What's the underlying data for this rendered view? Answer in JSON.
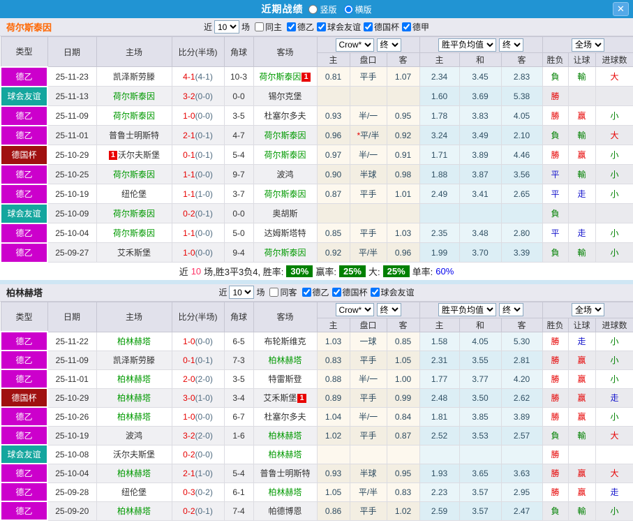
{
  "titlebar": {
    "title": "近期战绩",
    "vertical": "竖版",
    "horizontal": "横版",
    "selected": "横版",
    "close_label": "✕"
  },
  "colors": {
    "titlebar_bg": "#2194d3",
    "type_colors": {
      "德乙": "#cc00cc",
      "球会友谊": "#14a69e",
      "德国杯": "#a01010"
    },
    "team_green": "#009900",
    "score_red": "#e60000",
    "badge_red": "#e80000",
    "summary_green": "#008000"
  },
  "table_header": {
    "col_type": "类型",
    "col_date": "日期",
    "col_home": "主场",
    "col_score": "比分(半场)",
    "col_corner": "角球",
    "col_away": "客场",
    "odds_source": "Crow*",
    "final_a": "终",
    "avg_label": "胜平负均值",
    "final_b": "终",
    "scope": "全场",
    "sub_home": "主",
    "sub_handicap": "盘口",
    "sub_away": "客",
    "sub_avg_home": "主",
    "sub_avg_draw": "和",
    "sub_avg_away": "客",
    "col_result": "胜负",
    "col_handicap_result": "让球",
    "col_goals": "进球数"
  },
  "sections": [
    {
      "team": "荷尔斯泰因",
      "filter": {
        "near_label": "近",
        "count": "10",
        "games_label": "场",
        "same": {
          "label": "同主",
          "checked": false
        },
        "leagues": [
          {
            "label": "德乙",
            "checked": true
          },
          {
            "label": "球会友谊",
            "checked": true
          },
          {
            "label": "德国杯",
            "checked": true
          },
          {
            "label": "德甲",
            "checked": true
          }
        ]
      },
      "rows": [
        {
          "type": "德乙",
          "date": "25-11-23",
          "home": {
            "name": "凯泽斯劳滕"
          },
          "ft": "4-1",
          "ht": "(4-1)",
          "corner": "10-3",
          "away": {
            "name": "荷尔斯泰因",
            "green": true,
            "badge": "1",
            "badge_pos": "after"
          },
          "odds": [
            "0.81",
            "平手",
            "1.07"
          ],
          "avg": [
            "2.34",
            "3.45",
            "2.83"
          ],
          "res": [
            [
              "負",
              "g"
            ],
            [
              "輸",
              "g"
            ],
            [
              "大",
              "r"
            ]
          ]
        },
        {
          "type": "球会友谊",
          "date": "25-11-13",
          "home": {
            "name": "荷尔斯泰因",
            "green": true
          },
          "ft": "3-2",
          "ht": "(0-0)",
          "corner": "0-0",
          "away": {
            "name": "锡尔克堡"
          },
          "odds": [
            "",
            "",
            ""
          ],
          "avg": [
            "1.60",
            "3.69",
            "5.38"
          ],
          "res": [
            [
              "勝",
              "r"
            ],
            [
              "",
              ""
            ],
            [
              "",
              ""
            ]
          ]
        },
        {
          "type": "德乙",
          "date": "25-11-09",
          "home": {
            "name": "荷尔斯泰因",
            "green": true
          },
          "ft": "1-0",
          "ht": "(0-0)",
          "corner": "3-5",
          "away": {
            "name": "杜塞尔多夫"
          },
          "odds": [
            "0.93",
            "半/一",
            "0.95"
          ],
          "avg": [
            "1.78",
            "3.83",
            "4.05"
          ],
          "res": [
            [
              "勝",
              "r"
            ],
            [
              "赢",
              "r"
            ],
            [
              "小",
              "g"
            ]
          ]
        },
        {
          "type": "德乙",
          "date": "25-11-01",
          "home": {
            "name": "普鲁士明斯特"
          },
          "ft": "2-1",
          "ht": "(0-1)",
          "corner": "4-7",
          "away": {
            "name": "荷尔斯泰因",
            "green": true
          },
          "odds": [
            "0.96",
            "*平/半",
            "0.92"
          ],
          "avg": [
            "3.24",
            "3.49",
            "2.10"
          ],
          "res": [
            [
              "負",
              "g"
            ],
            [
              "輸",
              "g"
            ],
            [
              "大",
              "r"
            ]
          ]
        },
        {
          "type": "德国杯",
          "date": "25-10-29",
          "home": {
            "name": "沃尔夫斯堡",
            "badge": "1",
            "badge_pos": "before"
          },
          "ft": "0-1",
          "ht": "(0-1)",
          "corner": "5-4",
          "away": {
            "name": "荷尔斯泰因",
            "green": true
          },
          "odds": [
            "0.97",
            "半/一",
            "0.91"
          ],
          "avg": [
            "1.71",
            "3.89",
            "4.46"
          ],
          "res": [
            [
              "勝",
              "r"
            ],
            [
              "赢",
              "r"
            ],
            [
              "小",
              "g"
            ]
          ]
        },
        {
          "type": "德乙",
          "date": "25-10-25",
          "home": {
            "name": "荷尔斯泰因",
            "green": true
          },
          "ft": "1-1",
          "ht": "(0-0)",
          "corner": "9-7",
          "away": {
            "name": "波鸿"
          },
          "odds": [
            "0.90",
            "半球",
            "0.98"
          ],
          "avg": [
            "1.88",
            "3.87",
            "3.56"
          ],
          "res": [
            [
              "平",
              "b"
            ],
            [
              "輸",
              "g"
            ],
            [
              "小",
              "g"
            ]
          ]
        },
        {
          "type": "德乙",
          "date": "25-10-19",
          "home": {
            "name": "纽伦堡"
          },
          "ft": "1-1",
          "ht": "(1-0)",
          "corner": "3-7",
          "away": {
            "name": "荷尔斯泰因",
            "green": true
          },
          "odds": [
            "0.87",
            "平手",
            "1.01"
          ],
          "avg": [
            "2.49",
            "3.41",
            "2.65"
          ],
          "res": [
            [
              "平",
              "b"
            ],
            [
              "走",
              "b"
            ],
            [
              "小",
              "g"
            ]
          ]
        },
        {
          "type": "球会友谊",
          "date": "25-10-09",
          "home": {
            "name": "荷尔斯泰因",
            "green": true
          },
          "ft": "0-2",
          "ht": "(0-1)",
          "corner": "0-0",
          "away": {
            "name": "奥胡斯"
          },
          "odds": [
            "",
            "",
            ""
          ],
          "avg": [
            "",
            "",
            ""
          ],
          "res": [
            [
              "負",
              "g"
            ],
            [
              "",
              ""
            ],
            [
              "",
              ""
            ]
          ]
        },
        {
          "type": "德乙",
          "date": "25-10-04",
          "home": {
            "name": "荷尔斯泰因",
            "green": true
          },
          "ft": "1-1",
          "ht": "(0-0)",
          "corner": "5-0",
          "away": {
            "name": "达姆斯塔特"
          },
          "odds": [
            "0.85",
            "平手",
            "1.03"
          ],
          "avg": [
            "2.35",
            "3.48",
            "2.80"
          ],
          "res": [
            [
              "平",
              "b"
            ],
            [
              "走",
              "b"
            ],
            [
              "小",
              "g"
            ]
          ]
        },
        {
          "type": "德乙",
          "date": "25-09-27",
          "home": {
            "name": "艾禾斯堡"
          },
          "ft": "1-0",
          "ht": "(0-0)",
          "corner": "9-4",
          "away": {
            "name": "荷尔斯泰因",
            "green": true
          },
          "odds": [
            "0.92",
            "平/半",
            "0.96"
          ],
          "avg": [
            "1.99",
            "3.70",
            "3.39"
          ],
          "res": [
            [
              "負",
              "g"
            ],
            [
              "輸",
              "g"
            ],
            [
              "小",
              "g"
            ]
          ]
        }
      ],
      "summary": {
        "parts": [
          {
            "t": "近"
          },
          {
            "t": "10",
            "s": "pink"
          },
          {
            "t": "场,胜3平3负4, 胜率:"
          },
          {
            "t": "30%",
            "s": "gbox"
          },
          {
            "t": "赢率:"
          },
          {
            "t": "25%",
            "s": "gbox"
          },
          {
            "t": "大:"
          },
          {
            "t": "25%",
            "s": "gbox"
          },
          {
            "t": "单率:"
          },
          {
            "t": "60%",
            "s": "blue"
          }
        ]
      }
    },
    {
      "team": "柏林赫塔",
      "filter": {
        "near_label": "近",
        "count": "10",
        "games_label": "场",
        "same": {
          "label": "同客",
          "checked": false
        },
        "leagues": [
          {
            "label": "德乙",
            "checked": true
          },
          {
            "label": "德国杯",
            "checked": true
          },
          {
            "label": "球会友谊",
            "checked": true
          }
        ]
      },
      "rows": [
        {
          "type": "德乙",
          "date": "25-11-22",
          "home": {
            "name": "柏林赫塔",
            "green": true
          },
          "ft": "1-0",
          "ht": "(0-0)",
          "corner": "6-5",
          "away": {
            "name": "布轮斯维克"
          },
          "odds": [
            "1.03",
            "一球",
            "0.85"
          ],
          "avg": [
            "1.58",
            "4.05",
            "5.30"
          ],
          "res": [
            [
              "勝",
              "r"
            ],
            [
              "走",
              "b"
            ],
            [
              "小",
              "g"
            ]
          ]
        },
        {
          "type": "德乙",
          "date": "25-11-09",
          "home": {
            "name": "凯泽斯劳滕"
          },
          "ft": "0-1",
          "ht": "(0-1)",
          "corner": "7-3",
          "away": {
            "name": "柏林赫塔",
            "green": true
          },
          "odds": [
            "0.83",
            "平手",
            "1.05"
          ],
          "avg": [
            "2.31",
            "3.55",
            "2.81"
          ],
          "res": [
            [
              "勝",
              "r"
            ],
            [
              "赢",
              "r"
            ],
            [
              "小",
              "g"
            ]
          ]
        },
        {
          "type": "德乙",
          "date": "25-11-01",
          "home": {
            "name": "柏林赫塔",
            "green": true
          },
          "ft": "2-0",
          "ht": "(2-0)",
          "corner": "3-5",
          "away": {
            "name": "特雷斯登"
          },
          "odds": [
            "0.88",
            "半/一",
            "1.00"
          ],
          "avg": [
            "1.77",
            "3.77",
            "4.20"
          ],
          "res": [
            [
              "勝",
              "r"
            ],
            [
              "赢",
              "r"
            ],
            [
              "小",
              "g"
            ]
          ]
        },
        {
          "type": "德国杯",
          "date": "25-10-29",
          "home": {
            "name": "柏林赫塔",
            "green": true
          },
          "ft": "3-0",
          "ht": "(1-0)",
          "corner": "3-4",
          "away": {
            "name": "艾禾斯堡",
            "badge": "1",
            "badge_pos": "after"
          },
          "odds": [
            "0.89",
            "平手",
            "0.99"
          ],
          "avg": [
            "2.48",
            "3.50",
            "2.62"
          ],
          "res": [
            [
              "勝",
              "r"
            ],
            [
              "赢",
              "r"
            ],
            [
              "走",
              "b"
            ]
          ]
        },
        {
          "type": "德乙",
          "date": "25-10-26",
          "home": {
            "name": "柏林赫塔",
            "green": true
          },
          "ft": "1-0",
          "ht": "(0-0)",
          "corner": "6-7",
          "away": {
            "name": "杜塞尔多夫"
          },
          "odds": [
            "1.04",
            "半/一",
            "0.84"
          ],
          "avg": [
            "1.81",
            "3.85",
            "3.89"
          ],
          "res": [
            [
              "勝",
              "r"
            ],
            [
              "赢",
              "r"
            ],
            [
              "小",
              "g"
            ]
          ]
        },
        {
          "type": "德乙",
          "date": "25-10-19",
          "home": {
            "name": "波鸿"
          },
          "ft": "3-2",
          "ht": "(2-0)",
          "corner": "1-6",
          "away": {
            "name": "柏林赫塔",
            "green": true
          },
          "odds": [
            "1.02",
            "平手",
            "0.87"
          ],
          "avg": [
            "2.52",
            "3.53",
            "2.57"
          ],
          "res": [
            [
              "負",
              "g"
            ],
            [
              "輸",
              "g"
            ],
            [
              "大",
              "r"
            ]
          ]
        },
        {
          "type": "球会友谊",
          "date": "25-10-08",
          "home": {
            "name": "沃尔夫斯堡"
          },
          "ft": "0-2",
          "ht": "(0-0)",
          "corner": "",
          "away": {
            "name": "柏林赫塔",
            "green": true
          },
          "odds": [
            "",
            "",
            ""
          ],
          "avg": [
            "",
            "",
            ""
          ],
          "res": [
            [
              "勝",
              "r"
            ],
            [
              "",
              ""
            ],
            [
              "",
              ""
            ]
          ]
        },
        {
          "type": "德乙",
          "date": "25-10-04",
          "home": {
            "name": "柏林赫塔",
            "green": true
          },
          "ft": "2-1",
          "ht": "(1-0)",
          "corner": "5-4",
          "away": {
            "name": "普鲁士明斯特"
          },
          "odds": [
            "0.93",
            "半球",
            "0.95"
          ],
          "avg": [
            "1.93",
            "3.65",
            "3.63"
          ],
          "res": [
            [
              "勝",
              "r"
            ],
            [
              "赢",
              "r"
            ],
            [
              "大",
              "r"
            ]
          ]
        },
        {
          "type": "德乙",
          "date": "25-09-28",
          "home": {
            "name": "纽伦堡"
          },
          "ft": "0-3",
          "ht": "(0-2)",
          "corner": "6-1",
          "away": {
            "name": "柏林赫塔",
            "green": true
          },
          "odds": [
            "1.05",
            "平/半",
            "0.83"
          ],
          "avg": [
            "2.23",
            "3.57",
            "2.95"
          ],
          "res": [
            [
              "勝",
              "r"
            ],
            [
              "赢",
              "r"
            ],
            [
              "走",
              "b"
            ]
          ]
        },
        {
          "type": "德乙",
          "date": "25-09-20",
          "home": {
            "name": "柏林赫塔",
            "green": true
          },
          "ft": "0-2",
          "ht": "(0-1)",
          "corner": "7-4",
          "away": {
            "name": "帕德博恩"
          },
          "odds": [
            "0.86",
            "平手",
            "1.02"
          ],
          "avg": [
            "2.59",
            "3.57",
            "2.47"
          ],
          "res": [
            [
              "負",
              "g"
            ],
            [
              "輸",
              "g"
            ],
            [
              "小",
              "g"
            ]
          ]
        }
      ]
    }
  ]
}
